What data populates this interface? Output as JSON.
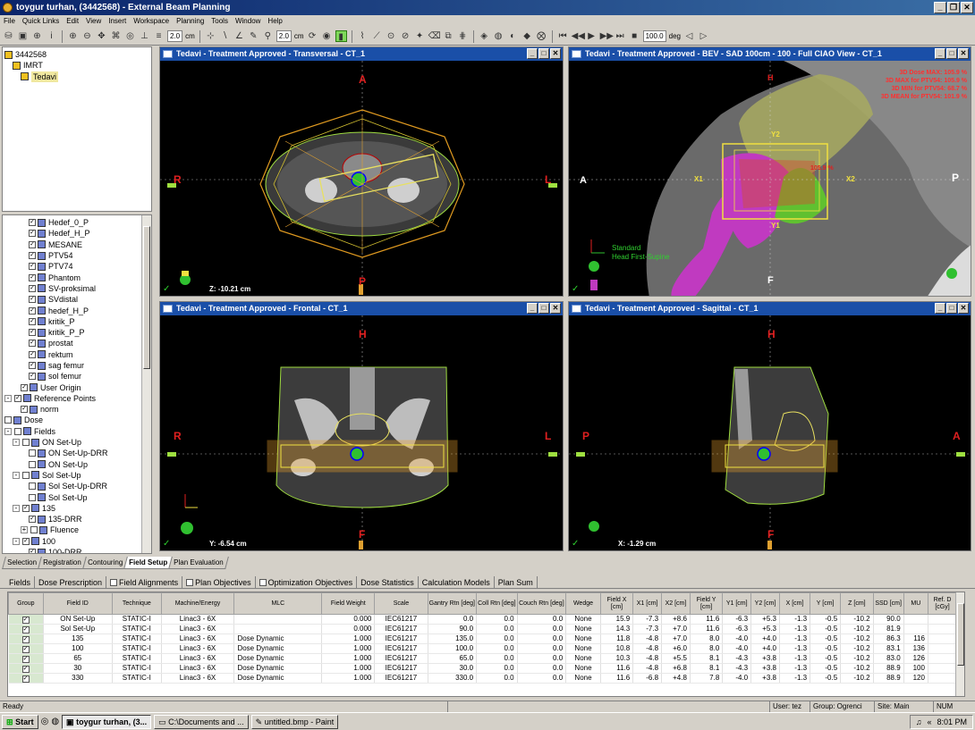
{
  "window": {
    "title": "toygur turhan,  (3442568) - External Beam Planning"
  },
  "menu": [
    "File",
    "Quick Links",
    "Edit",
    "View",
    "Insert",
    "Workspace",
    "Planning",
    "Tools",
    "Window",
    "Help"
  ],
  "toolbar": {
    "cm_value1": "2.0",
    "cm_unit1": "cm",
    "cm_value2": "2.0",
    "cm_unit2": "cm",
    "deg_value": "100.0",
    "deg_unit": "deg"
  },
  "tree_top": [
    {
      "label": "3442568",
      "icon": "patient-icon",
      "indent": 0
    },
    {
      "label": "IMRT",
      "icon": "course-icon",
      "indent": 1
    },
    {
      "label": "Tedavi",
      "icon": "plan-icon",
      "indent": 2,
      "selected": true
    }
  ],
  "tree_structures": [
    {
      "label": "Hedef_0_P",
      "indent": 3,
      "checked": true
    },
    {
      "label": "Hedef_H_P",
      "indent": 3,
      "checked": true
    },
    {
      "label": "MESANE",
      "indent": 3,
      "checked": true
    },
    {
      "label": "PTV54",
      "indent": 3,
      "checked": true
    },
    {
      "label": "PTV74",
      "indent": 3,
      "checked": true
    },
    {
      "label": "Phantom",
      "indent": 3,
      "checked": true
    },
    {
      "label": "SV-proksimal",
      "indent": 3,
      "checked": true
    },
    {
      "label": "SVdistal",
      "indent": 3,
      "checked": true
    },
    {
      "label": "hedef_H_P",
      "indent": 3,
      "checked": true
    },
    {
      "label": "kritik_P",
      "indent": 3,
      "checked": true
    },
    {
      "label": "kritik_P_P",
      "indent": 3,
      "checked": true
    },
    {
      "label": "prostat",
      "indent": 3,
      "checked": true
    },
    {
      "label": "rektum",
      "indent": 3,
      "checked": true
    },
    {
      "label": "sag femur",
      "indent": 3,
      "checked": true
    },
    {
      "label": "sol femur",
      "indent": 3,
      "checked": true
    },
    {
      "label": "User Origin",
      "indent": 2,
      "checked": true
    },
    {
      "label": "Reference Points",
      "indent": 0,
      "checked": true,
      "expander": "-"
    },
    {
      "label": "norm",
      "indent": 2,
      "checked": true
    },
    {
      "label": "Dose",
      "indent": 0,
      "checked": false
    },
    {
      "label": "Fields",
      "indent": 0,
      "checked": false,
      "expander": "-"
    },
    {
      "label": "ON Set-Up",
      "indent": 1,
      "checked": false,
      "expander": "-"
    },
    {
      "label": "ON Set-Up-DRR",
      "indent": 3,
      "checked": false
    },
    {
      "label": "ON Set-Up",
      "indent": 3,
      "checked": false
    },
    {
      "label": "Sol Set-Up",
      "indent": 1,
      "checked": false,
      "expander": "-"
    },
    {
      "label": "Sol Set-Up-DRR",
      "indent": 3,
      "checked": false
    },
    {
      "label": "Sol Set-Up",
      "indent": 3,
      "checked": false
    },
    {
      "label": "135",
      "indent": 1,
      "checked": true,
      "expander": "-"
    },
    {
      "label": "135-DRR",
      "indent": 3,
      "checked": true
    },
    {
      "label": "Fluence",
      "indent": 2,
      "checked": false,
      "expander": "+"
    },
    {
      "label": "100",
      "indent": 1,
      "checked": true,
      "expander": "-"
    },
    {
      "label": "100-DRR",
      "indent": 3,
      "checked": true
    }
  ],
  "viewports": {
    "transversal": {
      "title": "Tedavi  -  Treatment Approved - Transversal - CT_1",
      "top": "A",
      "left": "R",
      "right": "L",
      "bottom": "P",
      "coord": "Z: -10.21 cm"
    },
    "bev": {
      "title": "Tedavi  -  Treatment Approved - BEV  -  SAD 100cm  -  100  -  Full CIAO View - CT_1",
      "left": "A",
      "right": "P",
      "bottom": "F",
      "top": "H",
      "y2": "Y2",
      "y1": "Y1",
      "x1": "X1",
      "x2": "X2",
      "dose_lines": [
        "3D Dose MAX: 105.9 %",
        "3D MAX for PTV54: 105.9 %",
        "3D MIN for PTV54: 68.7 %",
        "3D MEAN for PTV54: 101.9 %"
      ],
      "pct_label": "105.9 %",
      "orientation_text": [
        "Standard",
        "Head First-Supine"
      ]
    },
    "frontal": {
      "title": "Tedavi  -  Treatment Approved - Frontal - CT_1",
      "top": "H",
      "left": "R",
      "right": "L",
      "bottom": "F",
      "coord": "Y: -6.54 cm"
    },
    "sagittal": {
      "title": "Tedavi  -  Treatment Approved - Sagittal - CT_1",
      "top": "H",
      "left": "P",
      "right": "A",
      "bottom": "F",
      "coord": "X: -1.29 cm"
    }
  },
  "bottom_tabs": [
    "Selection",
    "Registration",
    "Contouring",
    "Field Setup",
    "Plan Evaluation"
  ],
  "active_bottom_tab": "Field Setup",
  "plan_tabs": [
    {
      "label": "Fields",
      "checkbox": false
    },
    {
      "label": "Dose Prescription",
      "checkbox": false
    },
    {
      "label": "Field Alignments",
      "checkbox": true
    },
    {
      "label": "Plan Objectives",
      "checkbox": true
    },
    {
      "label": "Optimization Objectives",
      "checkbox": true
    },
    {
      "label": "Dose Statistics",
      "checkbox": false
    },
    {
      "label": "Calculation Models",
      "checkbox": false
    },
    {
      "label": "Plan Sum",
      "checkbox": false
    }
  ],
  "table": {
    "columns": [
      "Group",
      "Field ID",
      "Technique",
      "Machine/Energy",
      "MLC",
      "Field Weight",
      "Scale",
      "Gantry Rtn [deg]",
      "Coll Rtn [deg]",
      "Couch Rtn [deg]",
      "Wedge",
      "Field X [cm]",
      "X1 [cm]",
      "X2 [cm]",
      "Field Y [cm]",
      "Y1 [cm]",
      "Y2 [cm]",
      "X [cm]",
      "Y [cm]",
      "Z [cm]",
      "SSD [cm]",
      "MU",
      "Ref. D [cGy]"
    ],
    "rows": [
      [
        "",
        "ON Set-Up",
        "STATIC-I",
        "Linac3 - 6X",
        "",
        "0.000",
        "IEC61217",
        "0.0",
        "0.0",
        "0.0",
        "None",
        "15.9",
        "-7.3",
        "+8.6",
        "11.6",
        "-6.3",
        "+5.3",
        "-1.3",
        "-0.5",
        "-10.2",
        "90.0",
        "",
        ""
      ],
      [
        "",
        "Sol Set-Up",
        "STATIC-I",
        "Linac3 - 6X",
        "",
        "0.000",
        "IEC61217",
        "90.0",
        "0.0",
        "0.0",
        "None",
        "14.3",
        "-7.3",
        "+7.0",
        "11.6",
        "-6.3",
        "+5.3",
        "-1.3",
        "-0.5",
        "-10.2",
        "81.9",
        "",
        ""
      ],
      [
        "",
        "135",
        "STATIC-I",
        "Linac3 - 6X",
        "Dose Dynamic",
        "1.000",
        "IEC61217",
        "135.0",
        "0.0",
        "0.0",
        "None",
        "11.8",
        "-4.8",
        "+7.0",
        "8.0",
        "-4.0",
        "+4.0",
        "-1.3",
        "-0.5",
        "-10.2",
        "86.3",
        "116",
        ""
      ],
      [
        "",
        "100",
        "STATIC-I",
        "Linac3 - 6X",
        "Dose Dynamic",
        "1.000",
        "IEC61217",
        "100.0",
        "0.0",
        "0.0",
        "None",
        "10.8",
        "-4.8",
        "+6.0",
        "8.0",
        "-4.0",
        "+4.0",
        "-1.3",
        "-0.5",
        "-10.2",
        "83.1",
        "136",
        ""
      ],
      [
        "",
        "65",
        "STATIC-I",
        "Linac3 - 6X",
        "Dose Dynamic",
        "1.000",
        "IEC61217",
        "65.0",
        "0.0",
        "0.0",
        "None",
        "10.3",
        "-4.8",
        "+5.5",
        "8.1",
        "-4.3",
        "+3.8",
        "-1.3",
        "-0.5",
        "-10.2",
        "83.0",
        "126",
        ""
      ],
      [
        "",
        "30",
        "STATIC-I",
        "Linac3 - 6X",
        "Dose Dynamic",
        "1.000",
        "IEC61217",
        "30.0",
        "0.0",
        "0.0",
        "None",
        "11.6",
        "-4.8",
        "+6.8",
        "8.1",
        "-4.3",
        "+3.8",
        "-1.3",
        "-0.5",
        "-10.2",
        "88.9",
        "100",
        ""
      ],
      [
        "",
        "330",
        "STATIC-I",
        "Linac3 - 6X",
        "Dose Dynamic",
        "1.000",
        "IEC61217",
        "330.0",
        "0.0",
        "0.0",
        "None",
        "11.6",
        "-6.8",
        "+4.8",
        "7.8",
        "-4.0",
        "+3.8",
        "-1.3",
        "-0.5",
        "-10.2",
        "88.9",
        "120",
        ""
      ]
    ]
  },
  "status": {
    "left": "Ready",
    "user": "User: tez",
    "group": "Group: Ogrenci",
    "site": "Site: Main",
    "num": "NUM"
  },
  "taskbar": {
    "start": "Start",
    "items": [
      "toygur turhan,  (3...",
      "C:\\Documents and ...",
      "untitled.bmp - Paint"
    ],
    "clock": "8:01 PM"
  }
}
